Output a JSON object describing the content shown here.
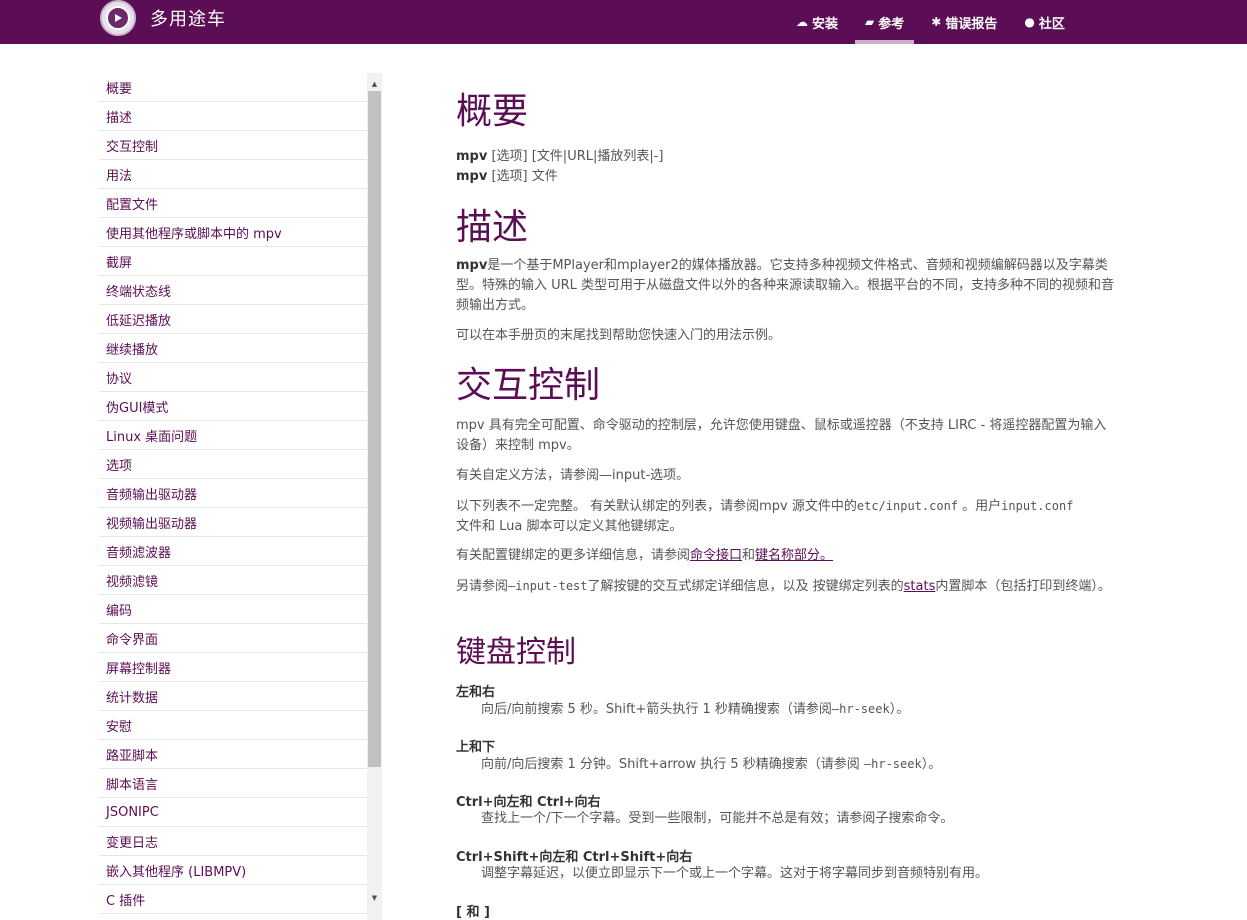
{
  "brand": {
    "title": "多用途车"
  },
  "nav": {
    "install": "安装",
    "reference": "参考",
    "bugs": "错误报告",
    "community": "社区"
  },
  "sidebar": {
    "items": [
      {
        "label": "概要"
      },
      {
        "label": "描述"
      },
      {
        "label": "交互控制"
      },
      {
        "label": "用法"
      },
      {
        "label": "配置文件"
      },
      {
        "label": "使用其他程序或脚本中的 mpv"
      },
      {
        "label": "截屏"
      },
      {
        "label": "终端状态线"
      },
      {
        "label": "低延迟播放"
      },
      {
        "label": "继续播放"
      },
      {
        "label": "协议"
      },
      {
        "label": "伪GUI模式"
      },
      {
        "label": "Linux 桌面问题"
      },
      {
        "label": "选项"
      },
      {
        "label": "音频输出驱动器"
      },
      {
        "label": "视频输出驱动器"
      },
      {
        "label": "音频滤波器"
      },
      {
        "label": "视频滤镜"
      },
      {
        "label": "编码"
      },
      {
        "label": "命令界面"
      },
      {
        "label": "屏幕控制器"
      },
      {
        "label": "统计数据"
      },
      {
        "label": "安慰"
      },
      {
        "label": "路亚脚本"
      },
      {
        "label": "脚本语言"
      },
      {
        "label": "JSONIPC"
      },
      {
        "label": "变更日志"
      },
      {
        "label": "嵌入其他程序 (LIBMPV)"
      },
      {
        "label": "C 插件"
      }
    ]
  },
  "content": {
    "synopsis": {
      "title": "概要",
      "line1_cmd": "mpv",
      "line1_rest": " [选项] [文件|URL|播放列表|-]",
      "line2_cmd": "mpv",
      "line2_rest": " [选项] 文件"
    },
    "description": {
      "title": "描述",
      "p1_bold": "mpv",
      "p1_rest": "是一个基于MPlayer和mplayer2的媒体播放器。它支持多种视频文件格式、音频和视频编解码器以及字幕类型。特殊的输入 URL 类型可用于从磁盘文件以外的各种来源读取输入。根据平台的不同，支持多种不同的视频和音频输出方式。",
      "p2": "可以在本手册页的末尾找到帮助您快速入门的用法示例。"
    },
    "interactive": {
      "title": "交互控制",
      "p1": "mpv 具有完全可配置、命令驱动的控制层，允许您使用键盘、鼠标或遥控器（不支持 LIRC - 将遥控器配置为输入设备）来控制 mpv。",
      "p2": "有关自定义方法，请参阅—input-选项。",
      "p3_a": "以下列表不一定完整。 有关默认绑定的列表，请参阅mpv 源文件中的",
      "p3_code1": "etc/input.conf",
      "p3_b": " 。用户",
      "p3_code2": "input.conf",
      "p3_c": "文件和 Lua 脚本可以定义其他键绑定。",
      "p4_a": "有关配置键绑定的更多详细信息，请参阅",
      "p4_link1": "命令接口",
      "p4_b": "和",
      "p4_link2": "键名称部分。",
      "p5_a": "另请参阅",
      "p5_code": "—input-test",
      "p5_b": "了解按键的交互式绑定详细信息，以及 按键绑定列表的",
      "p5_link": "stats",
      "p5_c": "内置脚本（包括打印到终端）。"
    },
    "keyboard": {
      "title": "键盘控制",
      "k1": "左和右",
      "d1_a": "向后/向前搜索 5 秒。Shift+箭头执行 1 秒精确搜索（请参阅",
      "d1_code": "—hr-seek",
      "d1_b": "）。",
      "k2": "上和下",
      "d2_a": "向前/向后搜索 1 分钟。Shift+arrow 执行 5 秒精确搜索（请参阅 ",
      "d2_code": "—hr-seek",
      "d2_b": "）。",
      "k3": "Ctrl+向左和 Ctrl+向右",
      "d3": "查找上一个/下一个字幕。受到一些限制，可能并不总是有效；请参阅子搜索命令。",
      "k4": "Ctrl+Shift+向左和 Ctrl+Shift+向右",
      "d4": "调整字幕延迟，以便立即显示下一个或上一个字幕。这对于将字幕同步到音频特别有用。",
      "k5": "[ 和 ]"
    }
  },
  "colors": {
    "brand": "#5b0e55",
    "text": "#555555"
  }
}
